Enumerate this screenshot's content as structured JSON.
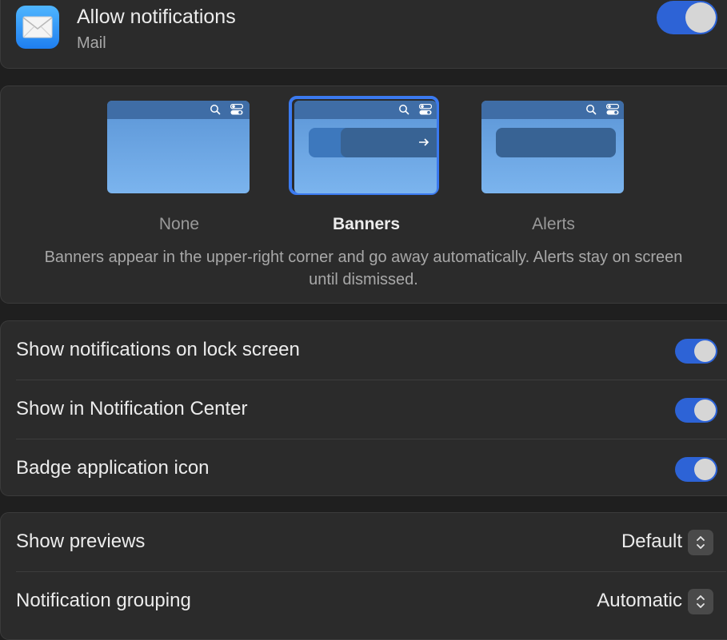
{
  "app": {
    "title": "Allow notifications",
    "subtitle": "Mail",
    "allow_enabled": true
  },
  "alert_style": {
    "options": [
      {
        "label": "None",
        "selected": false
      },
      {
        "label": "Banners",
        "selected": true
      },
      {
        "label": "Alerts",
        "selected": false
      }
    ],
    "description": "Banners appear in the upper-right corner and go away automatically. Alerts stay on screen until dismissed."
  },
  "toggles": [
    {
      "label": "Show notifications on lock screen",
      "enabled": true
    },
    {
      "label": "Show in Notification Center",
      "enabled": true
    },
    {
      "label": "Badge application icon",
      "enabled": true
    }
  ],
  "selects": [
    {
      "label": "Show previews",
      "value": "Default"
    },
    {
      "label": "Notification grouping",
      "value": "Automatic"
    }
  ],
  "colors": {
    "accent": "#2d63d6",
    "selection_ring": "#3b7af0"
  },
  "icons": {
    "app": "mail-envelope-icon",
    "search": "search-icon",
    "control_center": "control-center-icon",
    "arrow": "arrow-right-icon",
    "stepper": "chevron-up-down-icon"
  }
}
